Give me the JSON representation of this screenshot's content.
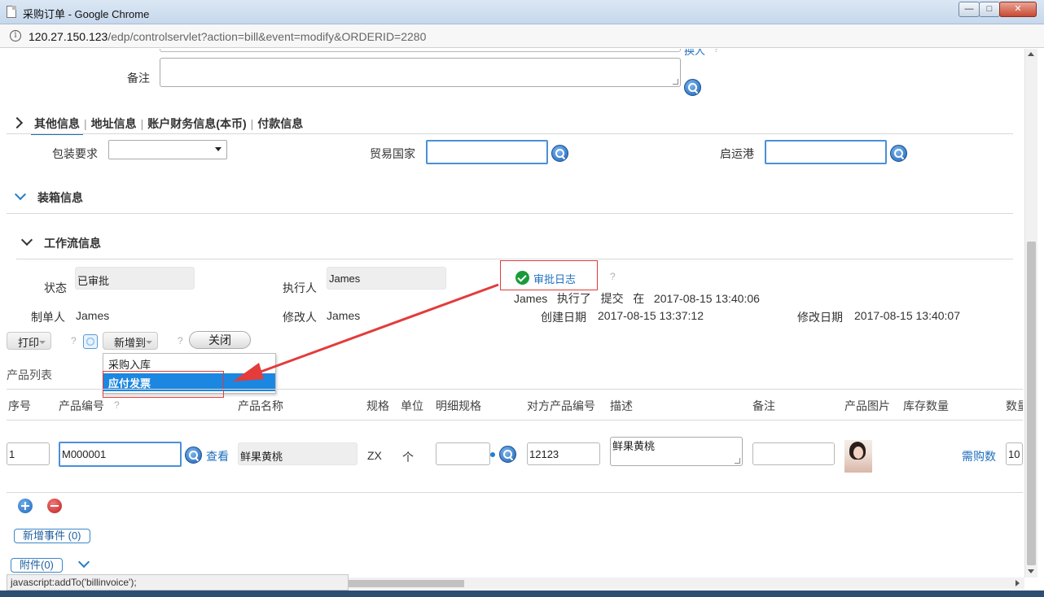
{
  "window": {
    "title": "采购订单 - Google Chrome",
    "min": "—",
    "max": "□",
    "close": "✕"
  },
  "address": {
    "host": "120.27.150.123",
    "path": "/edp/controlservlet?action=bill&event=modify&ORDERID=2280"
  },
  "top_form": {
    "cutoff_link": "换人",
    "remark_label": "备注",
    "remark_value": ""
  },
  "tabs": [
    {
      "label": "其他信息",
      "active": true
    },
    {
      "label": "地址信息"
    },
    {
      "label": "账户财务信息(本币)"
    },
    {
      "label": "付款信息"
    }
  ],
  "other_info": {
    "packaging_label": "包装要求",
    "packaging_value": "",
    "trade_country_label": "贸易国家",
    "trade_country_value": "",
    "port_label": "启运港",
    "port_value": ""
  },
  "sections": {
    "packing": "装箱信息",
    "workflow": "工作流信息"
  },
  "workflow": {
    "status_label": "状态",
    "status_value": "已审批",
    "executor_label": "执行人",
    "executor_value": "James",
    "approval_log_label": "审批日志",
    "log_line": "James   执行了   提交   在   2017-08-15 13:40:06",
    "creator_label": "制单人",
    "creator_value": "James",
    "modifier_label": "修改人",
    "modifier_value": "James",
    "created_label": "创建日期",
    "created_value": "2017-08-15 13:37:12",
    "modified_label": "修改日期",
    "modified_value": "2017-08-15 13:40:07"
  },
  "toolbar": {
    "print": "打印",
    "add_to": "新增到",
    "close": "关闭",
    "help": "?"
  },
  "dropdown_menu": {
    "items": [
      {
        "label": "采购入库",
        "selected": false
      },
      {
        "label": "应付发票",
        "selected": true
      }
    ]
  },
  "product_list": {
    "title": "产品列表",
    "columns": [
      "序号",
      "产品编号",
      "产品名称",
      "规格",
      "单位",
      "明细规格",
      "对方产品编号",
      "描述",
      "备注",
      "产品图片",
      "库存数量",
      "数量"
    ],
    "rows": [
      {
        "seq": "1",
        "code": "M000001",
        "view_link": "查看",
        "name": "鲜果黄桃",
        "spec": "ZX",
        "unit": "个",
        "detail_spec": "",
        "partner_code": "12123",
        "description": "鲜果黄桃",
        "remark": "",
        "need_qty_link": "需购数",
        "qty": "10"
      }
    ]
  },
  "footer": {
    "add_event": "新增事件 (0)",
    "attachments": "附件(0)"
  },
  "status_bar": "javascript:addTo('billinvoice');",
  "colors": {
    "accent": "#1f6fbf",
    "menu_selected": "#1c87e0",
    "annotation_red": "#e03a3a",
    "ok_green": "#1a9b3a"
  }
}
